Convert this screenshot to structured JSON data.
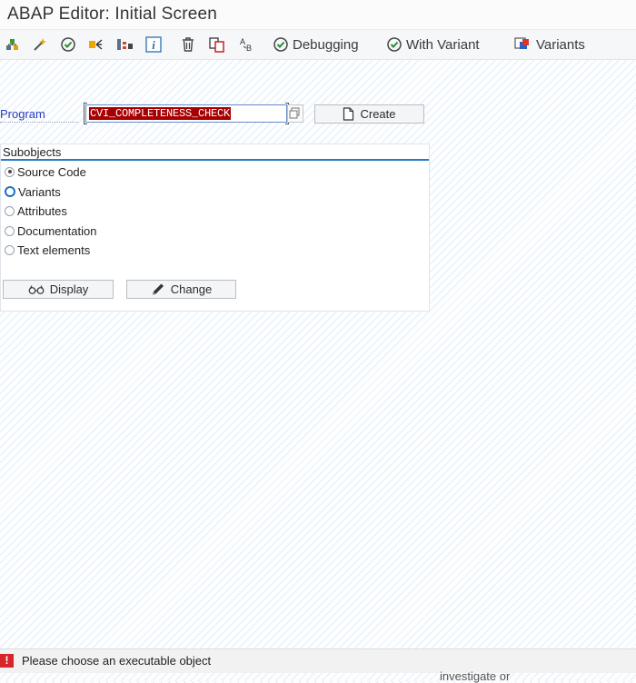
{
  "window": {
    "title": "ABAP Editor: Initial Screen"
  },
  "toolbar": {
    "icons": [
      "object-list-icon",
      "magic-wand-icon",
      "check-icon",
      "activate-icon",
      "where-used-icon",
      "info-icon",
      "delete-icon",
      "copy-icon",
      "rename-icon"
    ],
    "debugging_label": "Debugging",
    "with_variant_label": "With Variant",
    "variants_label": "Variants"
  },
  "form": {
    "program_label": "Program",
    "program_value": "CVI_COMPLETENESS_CHECK",
    "create_label": "Create"
  },
  "subobjects": {
    "title": "Subobjects",
    "options": [
      {
        "label": "Source Code",
        "selected": true
      },
      {
        "label": "Variants",
        "selected": false
      },
      {
        "label": "Attributes",
        "selected": false
      },
      {
        "label": "Documentation",
        "selected": false
      },
      {
        "label": "Text elements",
        "selected": false
      }
    ]
  },
  "actions": {
    "display_label": "Display",
    "change_label": "Change"
  },
  "status": {
    "type": "error",
    "icon": "!",
    "message": "Please choose an executable object"
  },
  "background_text": "investigate or",
  "colors": {
    "accent": "#2a7bc4",
    "highlight": "#a80000",
    "error": "#d6252b",
    "label": "#2a3cc0"
  }
}
